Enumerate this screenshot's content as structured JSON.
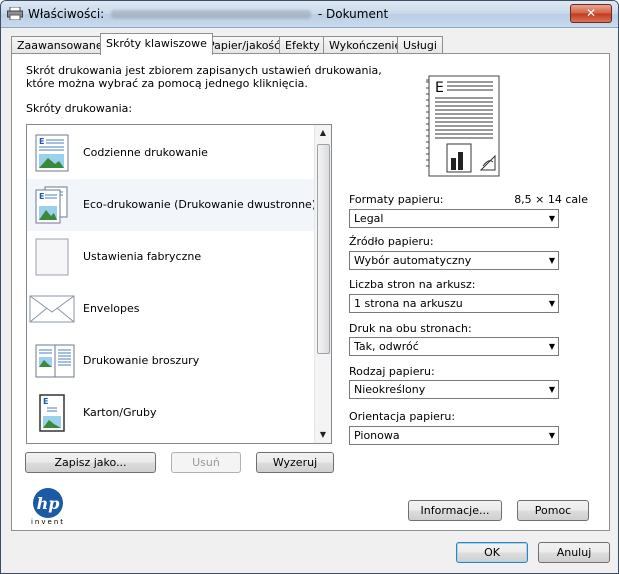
{
  "window": {
    "title_prefix": "Właściwości:",
    "title_suffix": "- Dokument",
    "close_label": "✕"
  },
  "tabs": [
    {
      "label": "Zaawansowane"
    },
    {
      "label": "Skróty klawiszowe"
    },
    {
      "label": "Papier/jakość"
    },
    {
      "label": "Efekty"
    },
    {
      "label": "Wykończenie"
    },
    {
      "label": "Usługi"
    }
  ],
  "panel": {
    "description": "Skrót drukowania jest zbiorem zapisanych ustawień drukowania, które można wybrać za pomocą jednego kliknięcia.",
    "shortcuts_label": "Skróty drukowania:",
    "shortcuts": [
      {
        "label": "Codzienne drukowanie",
        "icon": "document-icon"
      },
      {
        "label": "Eco-drukowanie (Drukowanie dwustronne)",
        "icon": "duplex-document-icon"
      },
      {
        "label": "Ustawienia fabryczne",
        "icon": "blank-page-icon"
      },
      {
        "label": "Envelopes",
        "icon": "envelope-icon"
      },
      {
        "label": "Drukowanie broszury",
        "icon": "booklet-icon"
      },
      {
        "label": "Karton/Gruby",
        "icon": "cardstock-icon"
      }
    ],
    "buttons": {
      "save_as": "Zapisz jako...",
      "delete": "Usuń",
      "reset": "Wyzeruj",
      "info": "Informacje...",
      "help": "Pomoc"
    },
    "paper_formats_label": "Formaty papieru:",
    "paper_size_value": "8,5 × 14 cale",
    "paper_format": "Legal",
    "paper_source_label": "Źródło papieru:",
    "paper_source": "Wybór automatyczny",
    "pages_per_sheet_label": "Liczba stron na arkusz:",
    "pages_per_sheet": "1 strona na arkuszu",
    "duplex_label": "Druk na obu stronach:",
    "duplex": "Tak, odwróć",
    "paper_type_label": "Rodzaj papieru:",
    "paper_type": "Nieokreślony",
    "orientation_label": "Orientacja papieru:",
    "orientation": "Pionowa",
    "logo_text": "invent"
  },
  "footer": {
    "ok": "OK",
    "cancel": "Anuluj"
  }
}
